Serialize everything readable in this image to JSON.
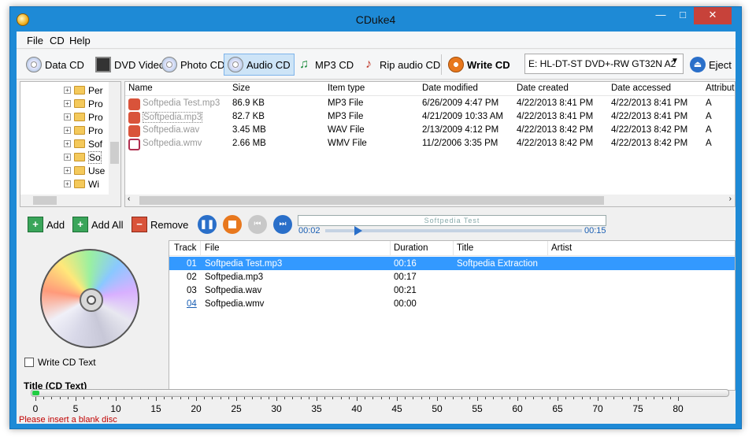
{
  "window": {
    "title": "CDuke4"
  },
  "menu": [
    "File",
    "CD",
    "Help"
  ],
  "toolbar": {
    "data_cd": "Data CD",
    "dvd_video": "DVD Video",
    "photo_cd": "Photo CD",
    "audio_cd": "Audio CD",
    "mp3_cd": "MP3 CD",
    "rip_audio_cd": "Rip audio CD",
    "write_cd": "Write CD",
    "drive": "E: HL-DT-ST DVD+-RW GT32N   A2",
    "eject": "Eject"
  },
  "tree": {
    "items": [
      "Per",
      "Pro",
      "Pro",
      "Pro",
      "Sof",
      "So",
      "Use",
      "Wi"
    ]
  },
  "filelist": {
    "columns": [
      "Name",
      "Size",
      "Item type",
      "Date modified",
      "Date created",
      "Date accessed",
      "Attribut"
    ],
    "rows": [
      {
        "name": "Softpedia Test.mp3",
        "size": "86.9 KB",
        "type": "MP3 File",
        "modified": "6/26/2009 4:47 PM",
        "created": "4/22/2013 8:41 PM",
        "accessed": "4/22/2013 8:41 PM",
        "attr": "A",
        "icon": "audio-file-icon"
      },
      {
        "name": "Softpedia.mp3",
        "size": "82.7 KB",
        "type": "MP3 File",
        "modified": "4/21/2009 10:33 AM",
        "created": "4/22/2013 8:41 PM",
        "accessed": "4/22/2013 8:41 PM",
        "attr": "A",
        "icon": "audio-file-icon"
      },
      {
        "name": "Softpedia.wav",
        "size": "3.45 MB",
        "type": "WAV File",
        "modified": "2/13/2009 4:12 PM",
        "created": "4/22/2013 8:42 PM",
        "accessed": "4/22/2013 8:42 PM",
        "attr": "A",
        "icon": "audio-file-icon"
      },
      {
        "name": "Softpedia.wmv",
        "size": "2.66 MB",
        "type": "WMV File",
        "modified": "11/2/2006 3:35 PM",
        "created": "4/22/2013 8:42 PM",
        "accessed": "4/22/2013 8:42 PM",
        "attr": "A",
        "icon": "video-file-icon"
      }
    ]
  },
  "track_toolbar": {
    "add": "Add",
    "add_all": "Add All",
    "remove": "Remove"
  },
  "player": {
    "now_playing": "Softpedia Test",
    "elapsed": "00:02",
    "total": "00:15",
    "progress_fraction": 0.13
  },
  "tracklist": {
    "columns": [
      "Track",
      "File",
      "Duration",
      "Title",
      "Artist"
    ],
    "rows": [
      {
        "track": "01",
        "file": "Softpedia Test.mp3",
        "duration": "00:16",
        "title": "Softpedia Extraction",
        "artist": ""
      },
      {
        "track": "02",
        "file": "Softpedia.mp3",
        "duration": "00:17",
        "title": "",
        "artist": ""
      },
      {
        "track": "03",
        "file": "Softpedia.wav",
        "duration": "00:21",
        "title": "",
        "artist": ""
      },
      {
        "track": "04",
        "file": "Softpedia.wmv",
        "duration": "00:00",
        "title": "",
        "artist": ""
      }
    ]
  },
  "write_cd_text": "Write CD Text",
  "cd_text_title": "Title (CD Text)",
  "capacity_ruler": {
    "labels": [
      "0",
      "5",
      "10",
      "15",
      "20",
      "25",
      "30",
      "35",
      "40",
      "45",
      "50",
      "55",
      "60",
      "65",
      "70",
      "75",
      "80"
    ],
    "fill_fraction": 0.01
  },
  "status": "Please insert a blank disc",
  "colors": {
    "titlebar": "#1e8ad6",
    "selection": "#3399ff",
    "status_text": "#c00000"
  }
}
